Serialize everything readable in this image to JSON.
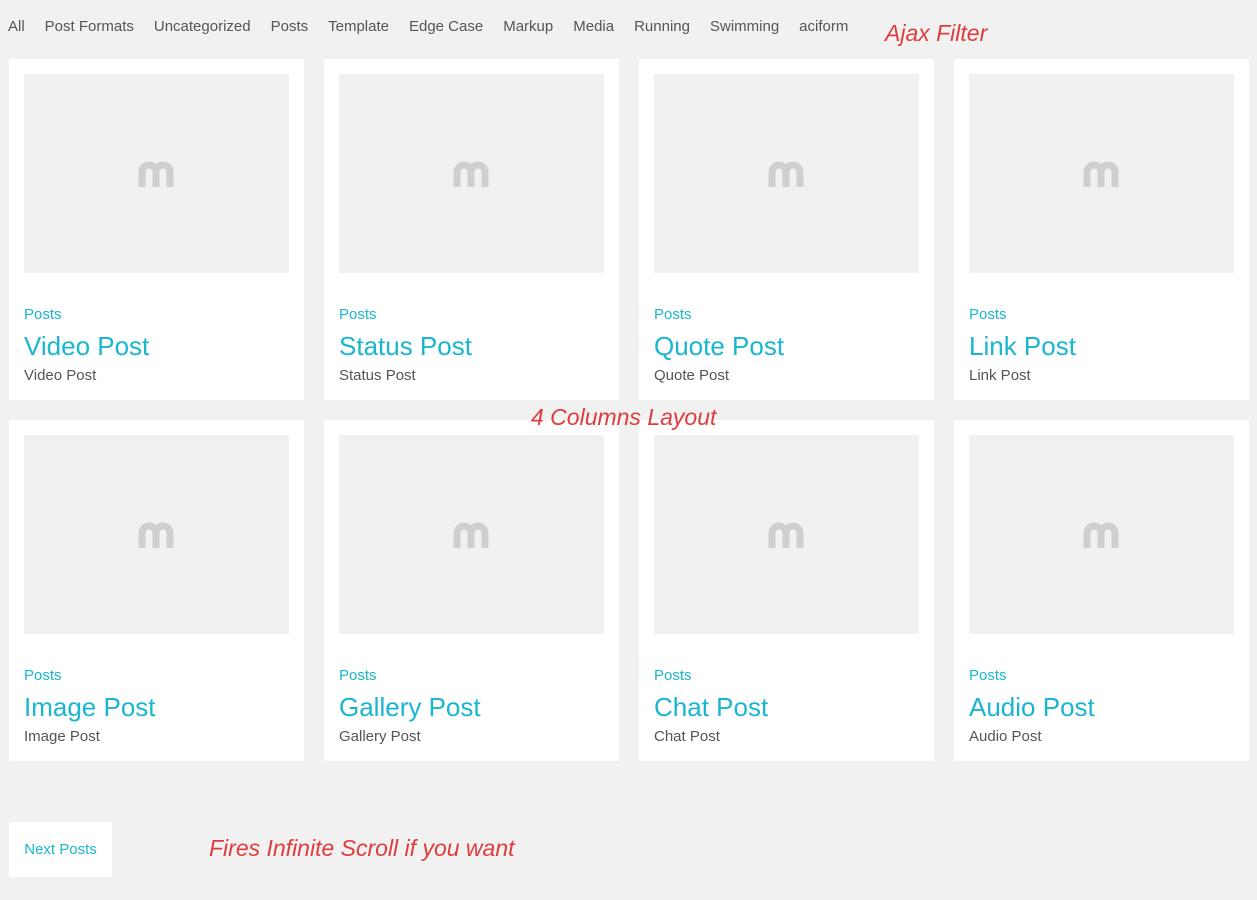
{
  "filter": {
    "items": [
      "All",
      "Post Formats",
      "Uncategorized",
      "Posts",
      "Template",
      "Edge Case",
      "Markup",
      "Media",
      "Running",
      "Swimming",
      "aciform"
    ]
  },
  "annotations": {
    "ajax_filter": "Ajax Filter",
    "columns_layout": "4 Columns Layout",
    "infinite_scroll": "Fires Infinite Scroll if you want"
  },
  "posts": [
    {
      "category": "Posts",
      "title": "Video Post",
      "excerpt": "Video Post",
      "icon": "placeholder-m-icon"
    },
    {
      "category": "Posts",
      "title": "Status Post",
      "excerpt": "Status Post",
      "icon": "placeholder-m-icon"
    },
    {
      "category": "Posts",
      "title": "Quote Post",
      "excerpt": "Quote Post",
      "icon": "placeholder-m-icon"
    },
    {
      "category": "Posts",
      "title": "Link Post",
      "excerpt": "Link Post",
      "icon": "placeholder-m-icon"
    },
    {
      "category": "Posts",
      "title": "Image Post",
      "excerpt": "Image Post",
      "icon": "placeholder-m-icon"
    },
    {
      "category": "Posts",
      "title": "Gallery Post",
      "excerpt": "Gallery Post",
      "icon": "placeholder-m-icon"
    },
    {
      "category": "Posts",
      "title": "Chat Post",
      "excerpt": "Chat Post",
      "icon": "placeholder-m-icon"
    },
    {
      "category": "Posts",
      "title": "Audio Post",
      "excerpt": "Audio Post",
      "icon": "placeholder-m-icon"
    }
  ],
  "pagination": {
    "next_label": "Next Posts"
  },
  "colors": {
    "accent": "#1ab6d0",
    "annotation": "#e03c3c",
    "background": "#f1f1f1"
  }
}
